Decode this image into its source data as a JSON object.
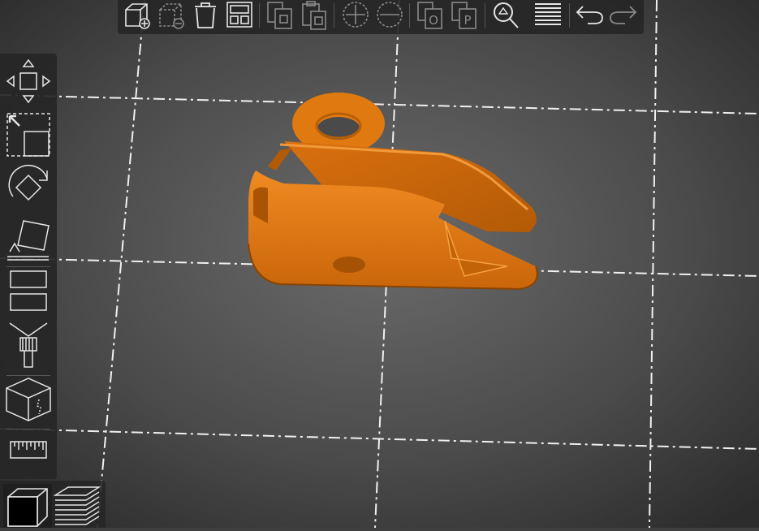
{
  "colors": {
    "background_center": "#6a6a6a",
    "background_edge": "#2d2d2d",
    "grid": "#f2f2f2",
    "model": "#e07a10",
    "model_shadow": "#8a4300",
    "toolbar_bg": "#262626",
    "icon": "#e6e6e6",
    "icon_disabled": "#8a8a8a"
  },
  "top_toolbar": {
    "buttons": [
      {
        "name": "add-object-icon",
        "enabled": true
      },
      {
        "name": "remove-object-icon",
        "enabled": false
      },
      {
        "name": "delete-all-icon",
        "enabled": true
      },
      {
        "name": "arrange-icon",
        "enabled": true
      },
      {
        "name": "copy-icon",
        "enabled": false
      },
      {
        "name": "paste-icon",
        "enabled": false
      },
      {
        "name": "add-instance-icon",
        "enabled": false
      },
      {
        "name": "remove-instance-icon",
        "enabled": false
      },
      {
        "name": "split-objects-icon",
        "enabled": false
      },
      {
        "name": "split-parts-icon",
        "enabled": false
      },
      {
        "name": "search-icon",
        "enabled": true
      },
      {
        "name": "layers-editing-icon",
        "enabled": true
      },
      {
        "name": "undo-icon",
        "enabled": true
      },
      {
        "name": "redo-icon",
        "enabled": false
      }
    ],
    "split_objects_letter": "O",
    "split_parts_letter": "P"
  },
  "left_toolbar": {
    "tools": [
      "move-icon",
      "scale-icon",
      "rotate-icon",
      "place-on-face-icon",
      "cut-icon",
      "paint-supports-icon",
      "seam-painting-icon",
      "measure-icon"
    ]
  },
  "view_toggle": {
    "buttons": [
      "3d-view-icon",
      "preview-layers-icon"
    ],
    "active": "3d-view-icon"
  }
}
